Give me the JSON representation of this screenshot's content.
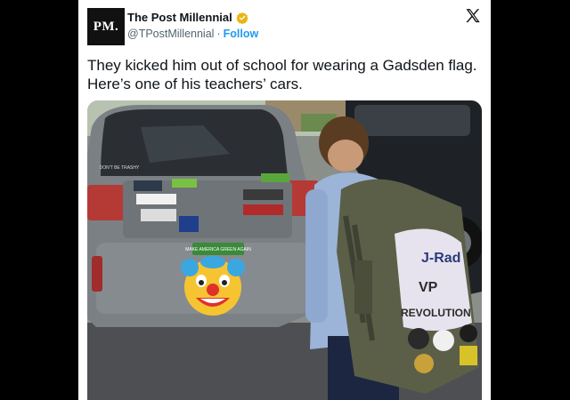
{
  "account": {
    "avatar_text": "PM.",
    "name": "The Post Millennial",
    "handle": "@TPostMillennial",
    "separator": "·",
    "follow_label": "Follow"
  },
  "tweet": {
    "text_line1": "They kicked him out of school for wearing a Gadsden flag.",
    "text_line2": "Here’s one of his teachers’ cars."
  },
  "photo": {
    "car_stickers": [
      "MAKE AMERICA GREEN AGAIN",
      "DON'T BE TRASHY"
    ],
    "backpack_text": [
      "J-Rad",
      "VP",
      "REVOLUTION"
    ]
  },
  "icons": [
    "verified-badge-icon",
    "x-logo-icon",
    "clown-emoji"
  ],
  "colors": {
    "link": "#1d9bf0",
    "verified": "#e8b511",
    "text": "#0f1419",
    "muted": "#536471"
  }
}
